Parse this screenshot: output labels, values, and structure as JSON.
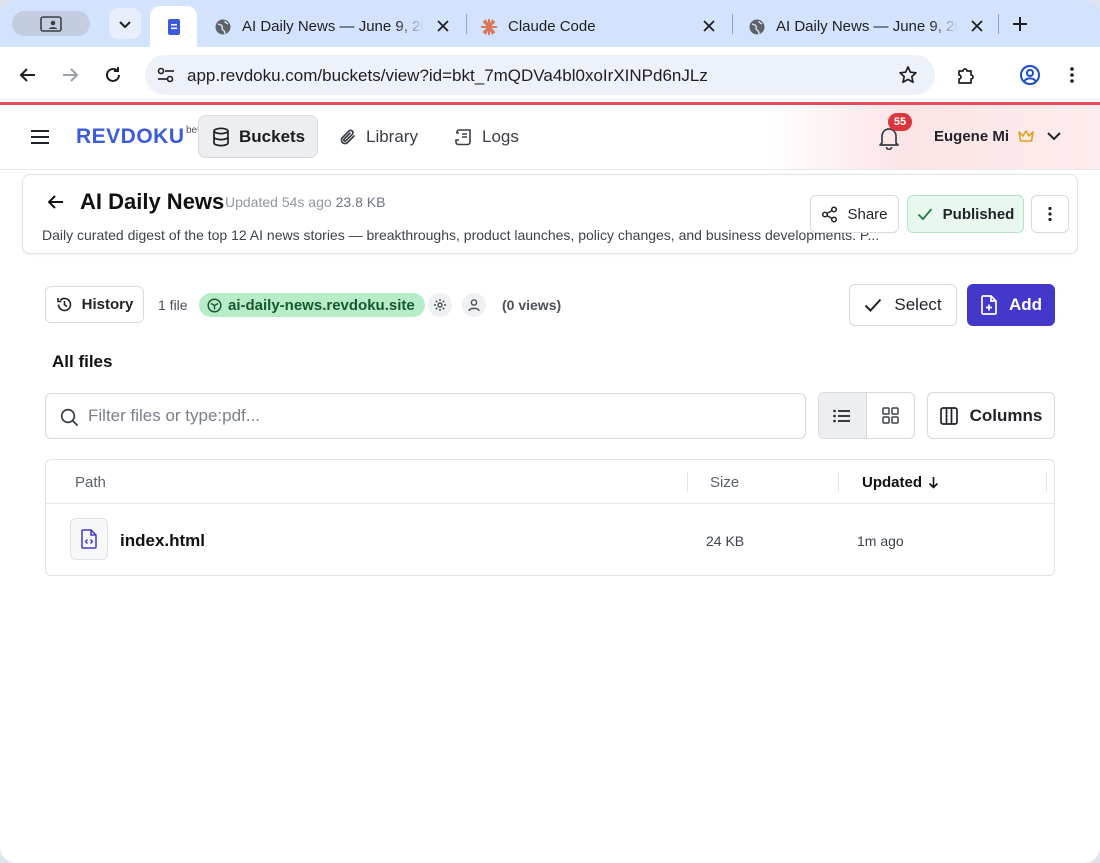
{
  "browser": {
    "tabs": [
      {
        "title": "AI Daily News — June 9, 2025",
        "active": false
      },
      {
        "title": "Claude Code",
        "active": false
      },
      {
        "title": "AI Daily News — June 9, 2025",
        "active": false
      }
    ],
    "url": "app.revdoku.com/buckets/view?id=bkt_7mQDVa4bl0xoIrXINPd6nJLz"
  },
  "app": {
    "brand": "REVDOKU",
    "beta": "beta",
    "nav": [
      {
        "label": "Buckets",
        "active": true
      },
      {
        "label": "Library",
        "active": false
      },
      {
        "label": "Logs",
        "active": false
      }
    ],
    "notifications": "55",
    "user_name": "Eugene Mi"
  },
  "bucket": {
    "title": "AI Daily News",
    "updated": "Updated 54s ago",
    "size": "23.8 KB",
    "description": "Daily curated digest of the top 12 AI news stories — breakthroughs, product launches, policy changes, and business developments. P...",
    "share_label": "Share",
    "published_label": "Published"
  },
  "info": {
    "history_label": "History",
    "file_count": "1 file",
    "domain": "ai-daily-news.revdoku.site",
    "views": "(0 views)",
    "select_label": "Select",
    "add_label": "Add"
  },
  "files": {
    "section_title": "All files",
    "filter_placeholder": "Filter files or type:pdf...",
    "columns_label": "Columns",
    "headers": {
      "path": "Path",
      "size": "Size",
      "updated": "Updated"
    },
    "rows": [
      {
        "name": "index.html",
        "size": "24 KB",
        "updated": "1m ago"
      }
    ]
  },
  "colors": {
    "brand": "#3b5bdb",
    "primary": "#4338ca",
    "published_bg": "#e9f8ef",
    "domain_pill": "#b7ecc6",
    "badge": "#d9363e"
  }
}
